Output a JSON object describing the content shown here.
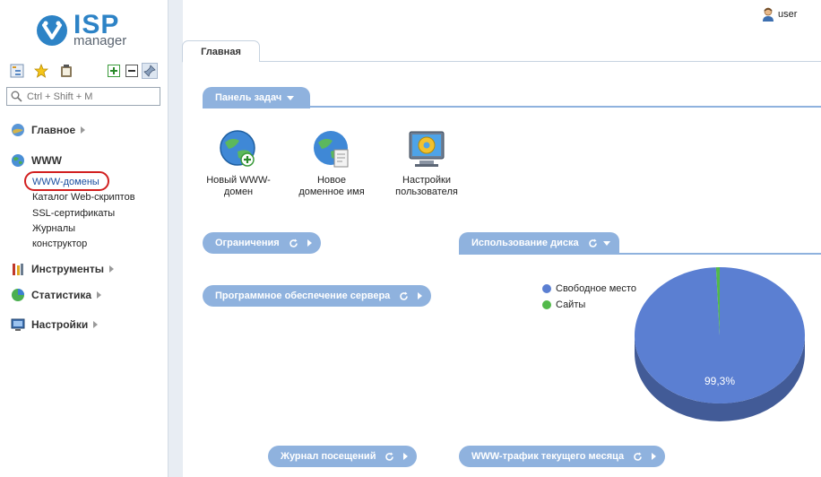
{
  "brand": {
    "name_main": "ISP",
    "name_sub": "manager"
  },
  "user": {
    "name": "user"
  },
  "sidebar": {
    "search_placeholder": "Ctrl + Shift + M",
    "groups": [
      {
        "label": "Главное",
        "icon": "home-globe-icon"
      },
      {
        "label": "WWW",
        "icon": "www-globe-icon",
        "items": [
          "WWW-домены",
          "Каталог Web-скриптов",
          "SSL-сертификаты",
          "Журналы",
          "конструктор"
        ]
      },
      {
        "label": "Инструменты",
        "icon": "tools-icon"
      },
      {
        "label": "Статистика",
        "icon": "pie-chart-icon"
      },
      {
        "label": "Настройки",
        "icon": "monitor-settings-icon"
      }
    ]
  },
  "tabs": [
    {
      "label": "Главная"
    }
  ],
  "panels": {
    "taskbar": {
      "title": "Панель задач"
    },
    "tasks": [
      {
        "label_line1": "Новый WWW-",
        "label_line2": "домен",
        "icon": "globe-plus-icon"
      },
      {
        "label_line1": "Новое",
        "label_line2": "доменное имя",
        "icon": "globe-page-icon"
      },
      {
        "label_line1": "Настройки",
        "label_line2": "пользователя",
        "icon": "gear-monitor-icon"
      }
    ],
    "limits": {
      "title": "Ограничения"
    },
    "software": {
      "title": "Программное обеспечение сервера"
    },
    "disk_usage": {
      "title": "Использование диска"
    },
    "visits_log": {
      "title": "Журнал посещений"
    },
    "traffic": {
      "title": "WWW-трафик текущего месяца"
    }
  },
  "chart_data": {
    "type": "pie",
    "title": "",
    "series": [
      {
        "name": "Свободное место",
        "value": 99.3,
        "color": "#5b7fd2"
      },
      {
        "name": "Сайты",
        "value": 0.7,
        "color": "#52b94a"
      }
    ],
    "data_labels": [
      "99,3%"
    ],
    "legend": "left"
  },
  "colors": {
    "accent": "#8fb2de",
    "brand": "#2d83c6",
    "highlight": "#d21f1f"
  }
}
